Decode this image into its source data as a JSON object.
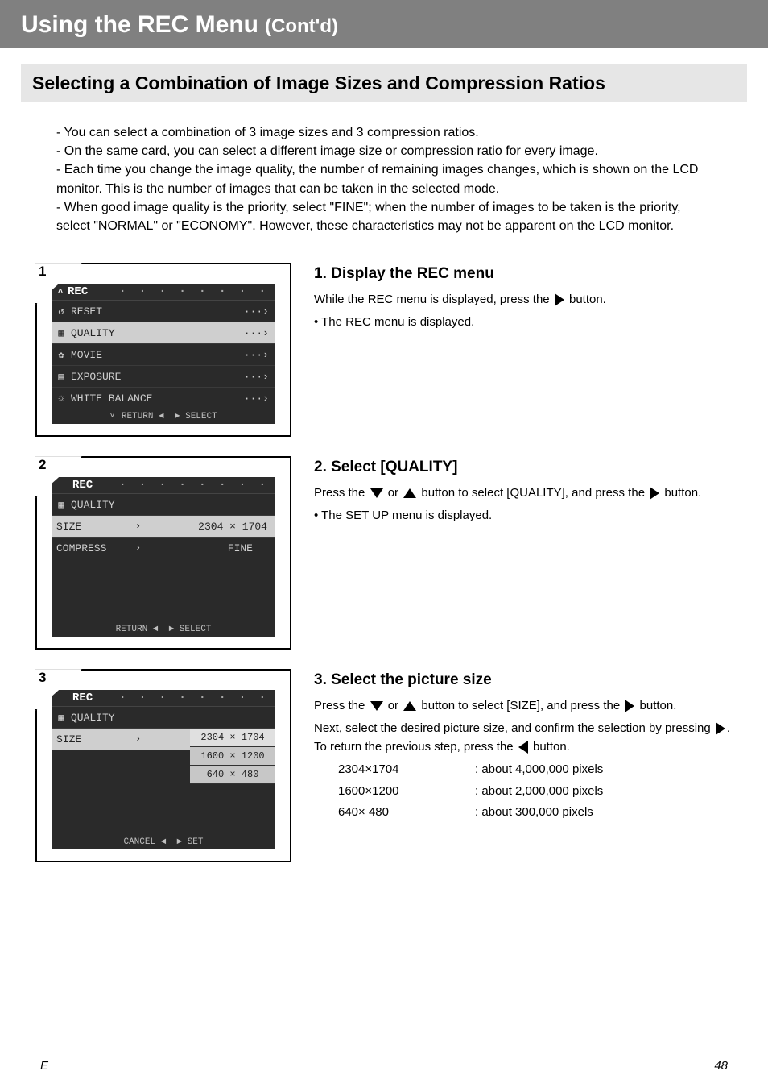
{
  "header": {
    "title_main": "Using the REC Menu",
    "title_sub": "(Cont'd)"
  },
  "subheader": "Selecting a Combination of Image Sizes and Compression Ratios",
  "intro_lines": [
    "- You can select a combination of 3 image sizes and 3 compression ratios.",
    "- On the same card, you can select a different image size or compression ratio for every image.",
    "- Each time you change the image quality, the number of remaining images changes, which is shown on the LCD monitor. This is the number of images that can be taken in the selected mode.",
    "- When good image quality is the priority, select \"FINE\"; when the number of images to be taken is the priority, select \"NORMAL\" or \"ECONOMY\". However, these characteristics may not be apparent on the LCD monitor."
  ],
  "steps": {
    "s1": {
      "num": "1",
      "screenshot": {
        "title": "REC",
        "rows": [
          {
            "icon": "↺",
            "label": "RESET",
            "sel": false
          },
          {
            "icon": "▦",
            "label": "QUALITY",
            "sel": true
          },
          {
            "icon": "✿",
            "label": "MOVIE",
            "sel": false
          },
          {
            "icon": "▤",
            "label": "EXPOSURE",
            "sel": false
          },
          {
            "icon": "☼",
            "label": "WHITE BALANCE",
            "sel": false
          }
        ],
        "footer_left": "RETURN ◄",
        "footer_right": "► SELECT"
      },
      "hint_title": "1. Display the REC menu",
      "hint_body": "While the REC menu is displayed, press the ",
      "hint_after": " button.",
      "bullet": "• The REC menu is displayed."
    },
    "s2": {
      "num": "2",
      "screenshot": {
        "title": "REC",
        "subtitle": "QUALITY",
        "rows": [
          {
            "label": "SIZE",
            "val": "2304 × 1704",
            "sel": true
          },
          {
            "label": "COMPRESS",
            "val": "FINE",
            "sel": false
          }
        ],
        "footer_left": "RETURN ◄",
        "footer_right": "► SELECT"
      },
      "hint_title": "2. Select [QUALITY]",
      "hint_body1": "Press the ",
      "hint_body2": " or ",
      "hint_body3": " button to select [QUALITY], and press the ",
      "hint_body4": " button.",
      "bullet": "• The SET UP menu is displayed."
    },
    "s3": {
      "num": "3",
      "screenshot": {
        "title": "REC",
        "subtitle": "QUALITY",
        "row_label": "SIZE",
        "options": [
          "2304 × 1704",
          "1600 × 1200",
          "640 × 480"
        ],
        "footer_left": "CANCEL ◄",
        "footer_right": "► SET"
      },
      "hint_title": "3. Select the picture size",
      "hint_body1": "Press the ",
      "hint_body2": " or ",
      "hint_body3": " button to select [SIZE], and press the ",
      "hint_body4": " button.",
      "body5": "Next, select the desired picture size, and confirm the selection by pressing ",
      "body6": ". To return the previous step, press the ",
      "body7": " button.",
      "sizes": [
        {
          "res": "2304×1704",
          "desc": ": about 4,000,000 pixels"
        },
        {
          "res": "1600×1200",
          "desc": ": about 2,000,000 pixels"
        },
        {
          "res": "640× 480",
          "desc": ": about   300,000 pixels"
        }
      ]
    }
  },
  "page_footer": {
    "left": "E",
    "right": "48"
  }
}
